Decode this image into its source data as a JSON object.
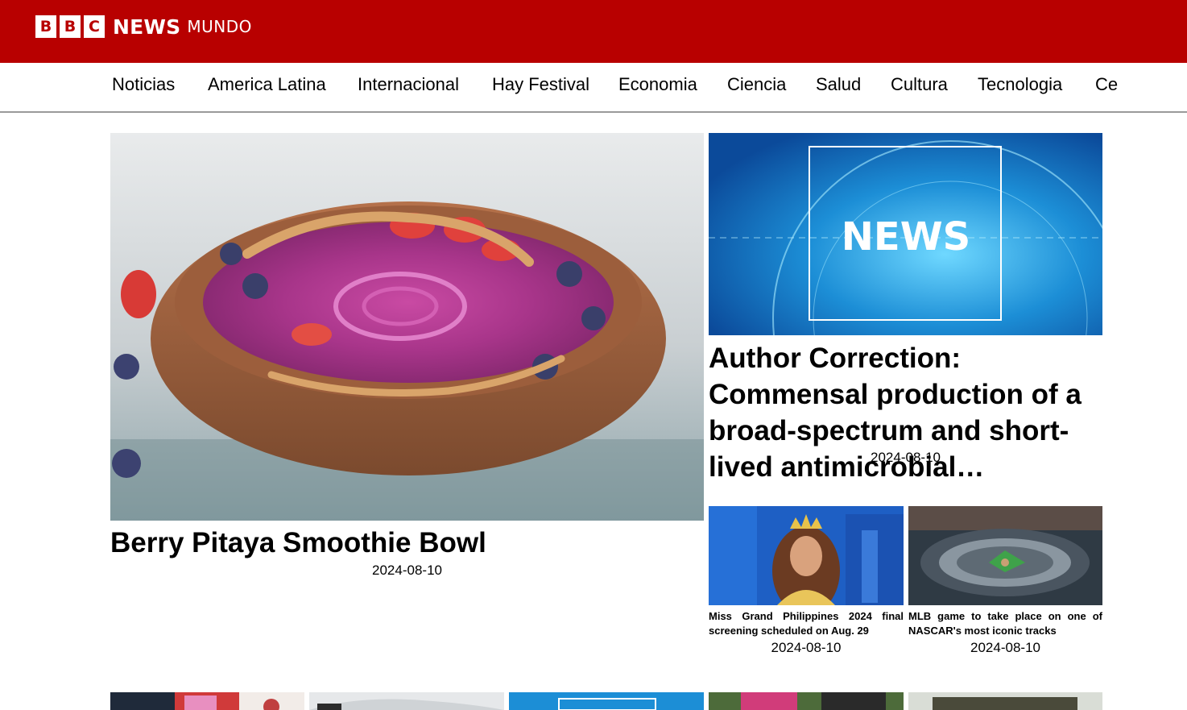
{
  "brand": {
    "logo_letters": [
      "B",
      "B",
      "C"
    ],
    "news": "NEWS",
    "mundo": "MUNDO",
    "accent_color": "#b80000"
  },
  "nav": {
    "items": [
      "Noticias",
      "America Latina",
      "Internacional",
      "Hay Festival",
      "Economia",
      "Ciencia",
      "Salud",
      "Cultura",
      "Tecnologia",
      "Ce"
    ]
  },
  "featured": {
    "title": "Berry Pitaya Smoothie Bowl",
    "date": "2024-08-10",
    "image": "smoothie-bowl-image"
  },
  "secondary": {
    "title": "Author Correction: Commensal production of a broad-spectrum and short-lived antimicrobial…",
    "date": "2024-08-10",
    "image_text": "NEWS"
  },
  "small_stories": [
    {
      "title": "Miss Grand Philippines 2024 final screening scheduled on Aug. 29",
      "date": "2024-08-10",
      "image": "pageant-image"
    },
    {
      "title": "MLB game to take place on one of NASCAR's most iconic tracks",
      "date": "2024-08-10",
      "image": "stadium-image"
    }
  ]
}
